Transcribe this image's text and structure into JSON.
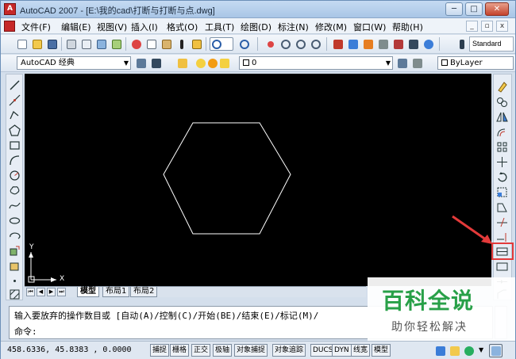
{
  "window": {
    "title": "AutoCAD 2007 - [E:\\我的cad\\打断与打断与点.dwg]",
    "minimize": "─",
    "restore": "□",
    "close": "✕"
  },
  "menu": {
    "items": [
      "文件(F)",
      "编辑(E)",
      "视图(V)",
      "插入(I)",
      "格式(O)",
      "工具(T)",
      "绘图(D)",
      "标注(N)",
      "修改(M)",
      "窗口(W)",
      "帮助(H)"
    ],
    "mdi_min": "_",
    "mdi_restore": "▫",
    "mdi_close": "x"
  },
  "toolbar": {
    "text_style": "Standard"
  },
  "workspace": {
    "selected": "AutoCAD 经典"
  },
  "layers": {
    "current": "0"
  },
  "color": {
    "current": "ByLayer"
  },
  "tabs": [
    {
      "label": "模型",
      "active": true
    },
    {
      "label": "布局1",
      "active": false
    },
    {
      "label": "布局2",
      "active": false
    }
  ],
  "ucs": {
    "x_label": "X",
    "y_label": "Y"
  },
  "command": {
    "history": "输入要放弃的操作数目或 [自动(A)/控制(C)/开始(BE)/结束(E)/标记(M)/",
    "prompt": "命令:"
  },
  "status": {
    "coords": "458.6336,  45.8383 , 0.0000",
    "buttons": [
      "捕捉",
      "栅格",
      "正交",
      "极轴",
      "对象捕捉",
      "对象追踪",
      "DUCS",
      "DYN",
      "线宽",
      "模型"
    ]
  },
  "watermark": {
    "title": "百科全说",
    "subtitle": "助你轻松解决"
  },
  "colors": {
    "canvas": "#000000",
    "drawing": "#ffffff",
    "highlight": "#e33a3a",
    "watermark": "#28a048"
  }
}
